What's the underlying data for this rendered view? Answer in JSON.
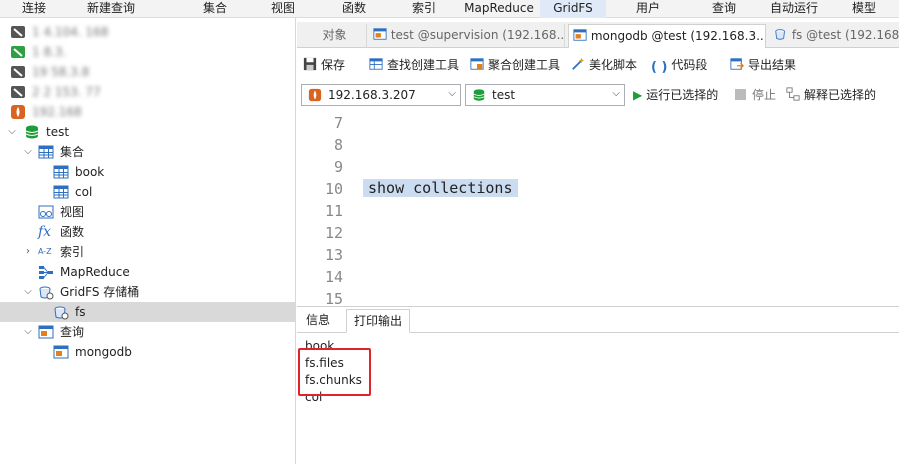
{
  "menu": [
    "连接",
    "新建查询",
    "集合",
    "视图",
    "函数",
    "索引",
    "MapReduce",
    "GridFS",
    "用户",
    "查询",
    "自动运行",
    "模型"
  ],
  "menu_active": "GridFS",
  "tree": {
    "connections": [
      {
        "label": "1 4.104.  168",
        "icon": "connection-icon"
      },
      {
        "label": "1  8.3.",
        "icon": "connection-icon"
      },
      {
        "label": "19  58.3.8",
        "icon": "connection-icon"
      },
      {
        "label": "2  2  153.  77",
        "icon": "connection-icon"
      },
      {
        "label": "192.168",
        "icon": "mongodb-leaf-icon"
      }
    ],
    "db": "test",
    "collections_label": "集合",
    "collections": [
      "book",
      "col"
    ],
    "views_label": "视图",
    "functions_label": "函数",
    "indexes_label": "索引",
    "mapreduce_label": "MapReduce",
    "gridfs_label": "GridFS 存储桶",
    "gridfs_items": [
      "fs"
    ],
    "queries_label": "查询",
    "queries": [
      "mongodb"
    ]
  },
  "tabs": [
    {
      "label": "对象"
    },
    {
      "label": "test @supervision (192.168...."
    },
    {
      "label": "mongodb @test (192.168.3...."
    },
    {
      "label": "fs @test (192.168.3"
    }
  ],
  "toolbar": {
    "save": "保存",
    "find_builder": "查找创建工具",
    "aggregate_builder": "聚合创建工具",
    "beautify": "美化脚本",
    "snippet": "代码段",
    "export": "导出结果"
  },
  "selectors": {
    "connection": "192.168.3.207",
    "database": "test",
    "run_selected": "运行已选择的",
    "stop": "停止",
    "explain_selected": "解释已选择的"
  },
  "editor": {
    "lines": [
      "7",
      "8",
      "9",
      "10",
      "11",
      "12",
      "13",
      "14",
      "15"
    ],
    "code": "show collections"
  },
  "output_tabs": [
    "信息",
    "打印输出"
  ],
  "output_lines": [
    "book",
    "fs.files",
    "fs.chunks",
    "col"
  ],
  "colors": {
    "highlight": "#e0242a",
    "accent_green": "#1f9d3a",
    "selection": "#cbdcf0"
  }
}
